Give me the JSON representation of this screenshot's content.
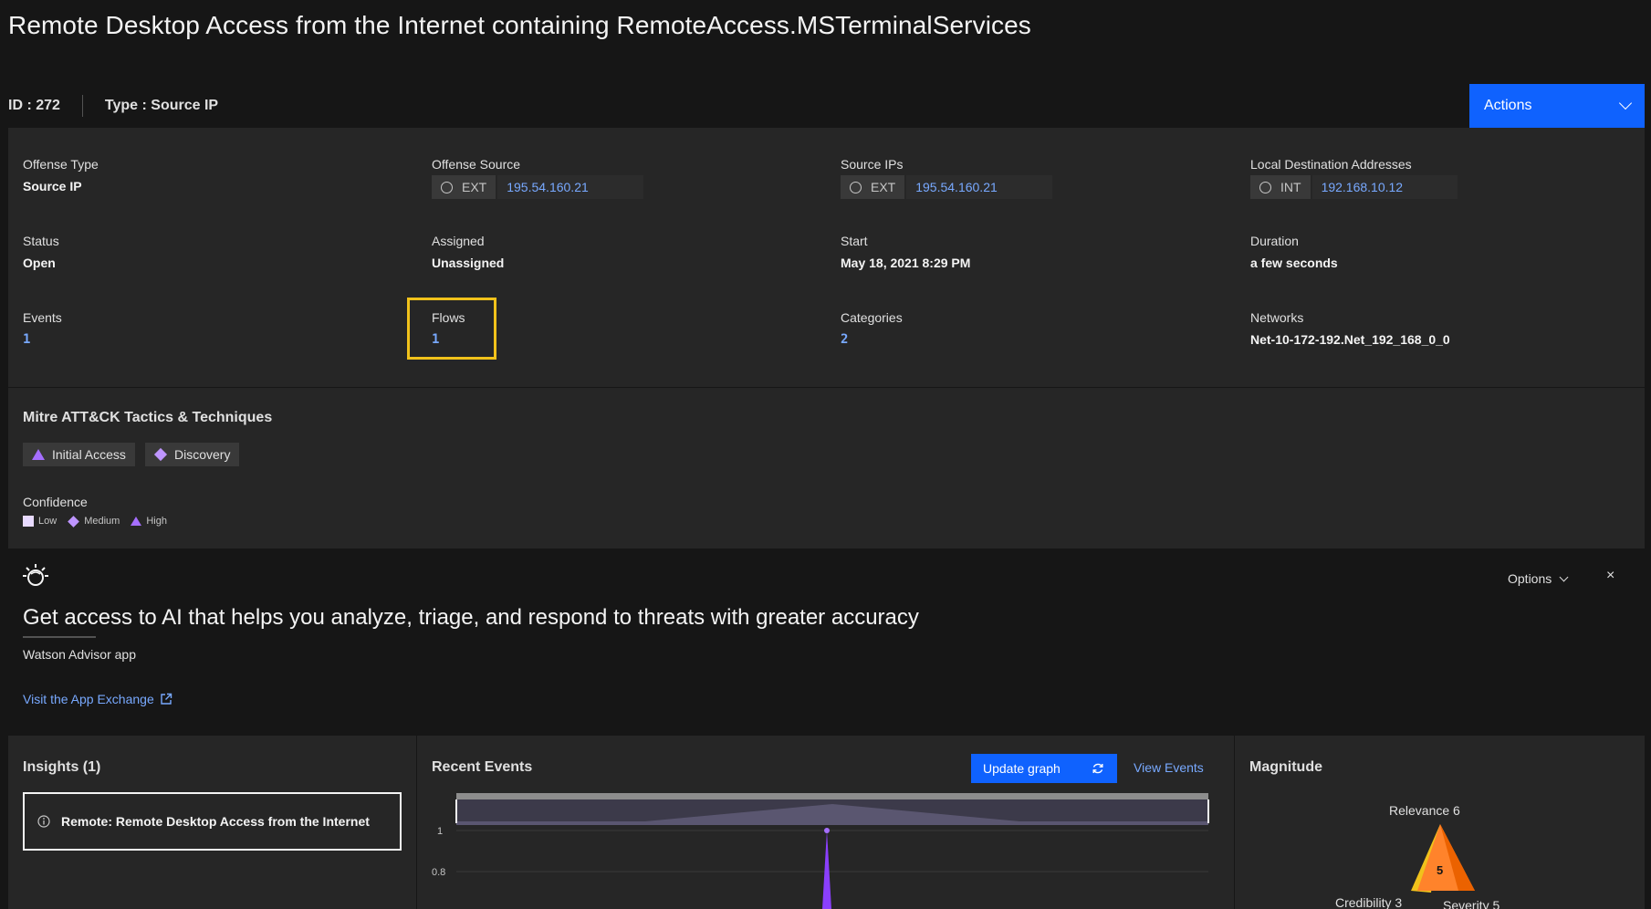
{
  "header": {
    "title": "Remote Desktop Access from the Internet containing RemoteAccess.MSTerminalServices",
    "id_label": "ID : 272",
    "type_label": "Type : Source IP",
    "actions_label": "Actions"
  },
  "summary": {
    "offense_type": {
      "label": "Offense Type",
      "value": "Source IP"
    },
    "offense_source": {
      "label": "Offense Source",
      "kind": "EXT",
      "value": "195.54.160.21"
    },
    "source_ips": {
      "label": "Source IPs",
      "kind": "EXT",
      "value": "195.54.160.21"
    },
    "local_dest": {
      "label": "Local Destination Addresses",
      "kind": "INT",
      "value": "192.168.10.12"
    },
    "status": {
      "label": "Status",
      "value": "Open"
    },
    "assigned": {
      "label": "Assigned",
      "value": "Unassigned"
    },
    "start": {
      "label": "Start",
      "value": "May 18, 2021 8:29 PM"
    },
    "duration": {
      "label": "Duration",
      "value": "a few seconds"
    },
    "events": {
      "label": "Events",
      "value": "1"
    },
    "flows": {
      "label": "Flows",
      "value": "1"
    },
    "categories": {
      "label": "Categories",
      "value": "2"
    },
    "networks": {
      "label": "Networks",
      "value": "Net-10-172-192.Net_192_168_0_0"
    }
  },
  "mitre": {
    "heading": "Mitre ATT&CK Tactics & Techniques",
    "tags": [
      {
        "label": "Initial Access",
        "icon": "triangle-icon"
      },
      {
        "label": "Discovery",
        "icon": "diamond-icon"
      }
    ],
    "confidence_label": "Confidence",
    "legend": {
      "low": "Low",
      "medium": "Medium",
      "high": "High"
    }
  },
  "watson": {
    "options_label": "Options",
    "close_label": "×",
    "headline": "Get access to AI that helps you analyze, triage, and respond to threats with greater accuracy",
    "subtitle": "Watson Advisor app",
    "visit_label": "Visit the App Exchange"
  },
  "insights": {
    "heading": "Insights (1)",
    "card_text": "Remote: Remote Desktop Access from the Internet"
  },
  "recent_events": {
    "heading": "Recent Events",
    "update_label": "Update graph",
    "view_label": "View Events",
    "y_ticks": [
      "1",
      "0.8"
    ]
  },
  "magnitude": {
    "heading": "Magnitude",
    "relevance": "Relevance 6",
    "credibility": "Credibility 3",
    "severity": "Severity 5",
    "value": "5"
  },
  "colors": {
    "accent": "#0f62fe",
    "link": "#78a9ff",
    "highlight": "#f1c21b",
    "purple": "#a56eff",
    "magnitude_orange": "#ff832b"
  }
}
